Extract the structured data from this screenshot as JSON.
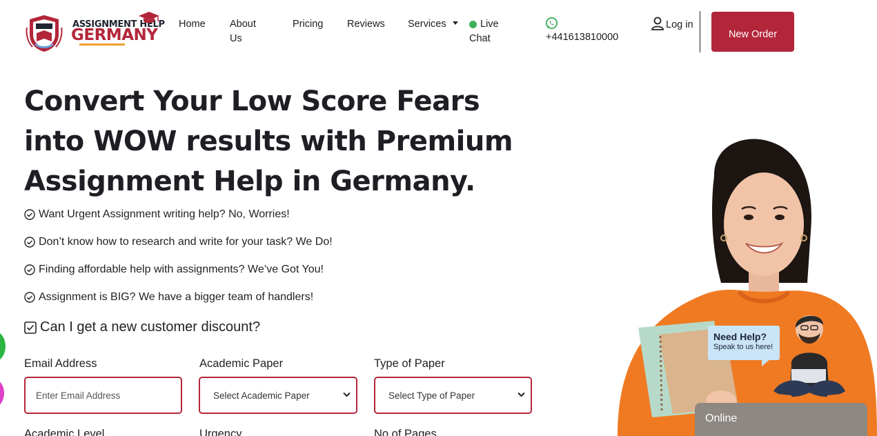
{
  "logo": {
    "line1": "ASSIGNMENT HELP",
    "line2": "GERMANY"
  },
  "nav": {
    "home": "Home",
    "about": "About Us",
    "pricing": "Pricing",
    "reviews": "Reviews",
    "services": "Services",
    "live_chat": "Live Chat",
    "phone": "+441613810000",
    "login": "Log in",
    "new_order": "New Order"
  },
  "hero": {
    "title": "Convert Your Low Score Fears into WOW results with Premium Assignment Help in Germany.",
    "bullets": [
      "Want Urgent Assignment writing help? No, Worries!",
      "Don’t know how to research and write for your task? We Do!",
      "Finding affordable help with assignments? We’ve Got You!",
      "Assignment is BIG? We have a bigger team of handlers!"
    ],
    "discount": "Can I get a new customer discount?"
  },
  "form": {
    "email_label": "Email Address",
    "email_placeholder": "Enter Email Address",
    "paper_label": "Academic Paper",
    "paper_value": "Select Academic Paper",
    "type_label": "Type of Paper",
    "type_value": "Select Type of Paper",
    "level_label": "Academic Level",
    "urgency_label": "Urgency",
    "pages_label": "No of Pages"
  },
  "chat": {
    "need_help": "Need Help?",
    "speak": "Speak to us here!",
    "online": "Online"
  },
  "colors": {
    "brand": "#b3263a",
    "live": "#3fb05a",
    "online_bar": "#8e8883"
  }
}
